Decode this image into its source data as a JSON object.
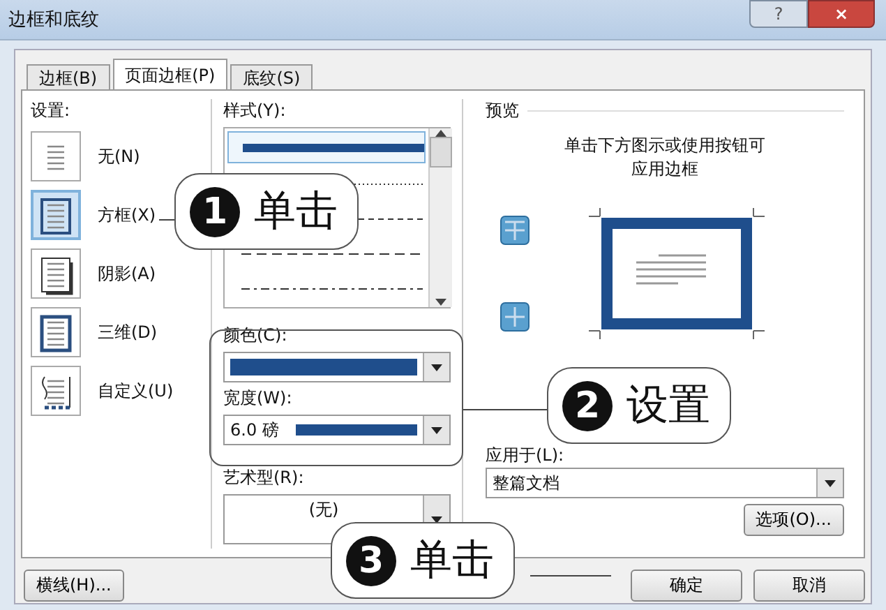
{
  "window": {
    "title": "边框和底纹",
    "help": "?",
    "close": "×"
  },
  "tabs": [
    {
      "label": "边框(B)",
      "selected": false
    },
    {
      "label": "页面边框(P)",
      "selected": true
    },
    {
      "label": "底纹(S)",
      "selected": false
    }
  ],
  "settings": {
    "label": "设置:",
    "items": [
      {
        "label": "无(N)",
        "kind": "none",
        "selected": false
      },
      {
        "label": "方框(X)",
        "kind": "box",
        "selected": true
      },
      {
        "label": "阴影(A)",
        "kind": "shadow",
        "selected": false
      },
      {
        "label": "三维(D)",
        "kind": "raised",
        "selected": false
      },
      {
        "label": "自定义(U)",
        "kind": "custom",
        "selected": false
      }
    ]
  },
  "style": {
    "label": "样式(Y):",
    "items": [
      {
        "kind": "thick",
        "selected": true
      },
      {
        "kind": "dotted",
        "selected": false
      },
      {
        "kind": "dashed",
        "selected": false
      },
      {
        "kind": "long-dash",
        "selected": false
      },
      {
        "kind": "dash-dot",
        "selected": false
      }
    ]
  },
  "color": {
    "label": "颜色(C):",
    "color": "#1f4e8c"
  },
  "width": {
    "label": "宽度(W):",
    "value": "6.0 磅"
  },
  "art": {
    "label": "艺术型(R):",
    "value": "(无)"
  },
  "preview": {
    "title": "预览",
    "hint": "单击下方图示或使用按钮可应用边框"
  },
  "apply": {
    "label": "应用于(L):",
    "value": "整篇文档"
  },
  "options_button": "选项(O)...",
  "bottom_buttons": [
    {
      "label": "横线(H)...",
      "kind": "left"
    },
    {
      "label": "确定",
      "kind": "ok"
    },
    {
      "label": "取消",
      "kind": "cancel"
    }
  ],
  "callouts": [
    {
      "number": "1",
      "text": "单击"
    },
    {
      "number": "2",
      "text": "设置"
    },
    {
      "number": "3",
      "text": "单击"
    }
  ]
}
